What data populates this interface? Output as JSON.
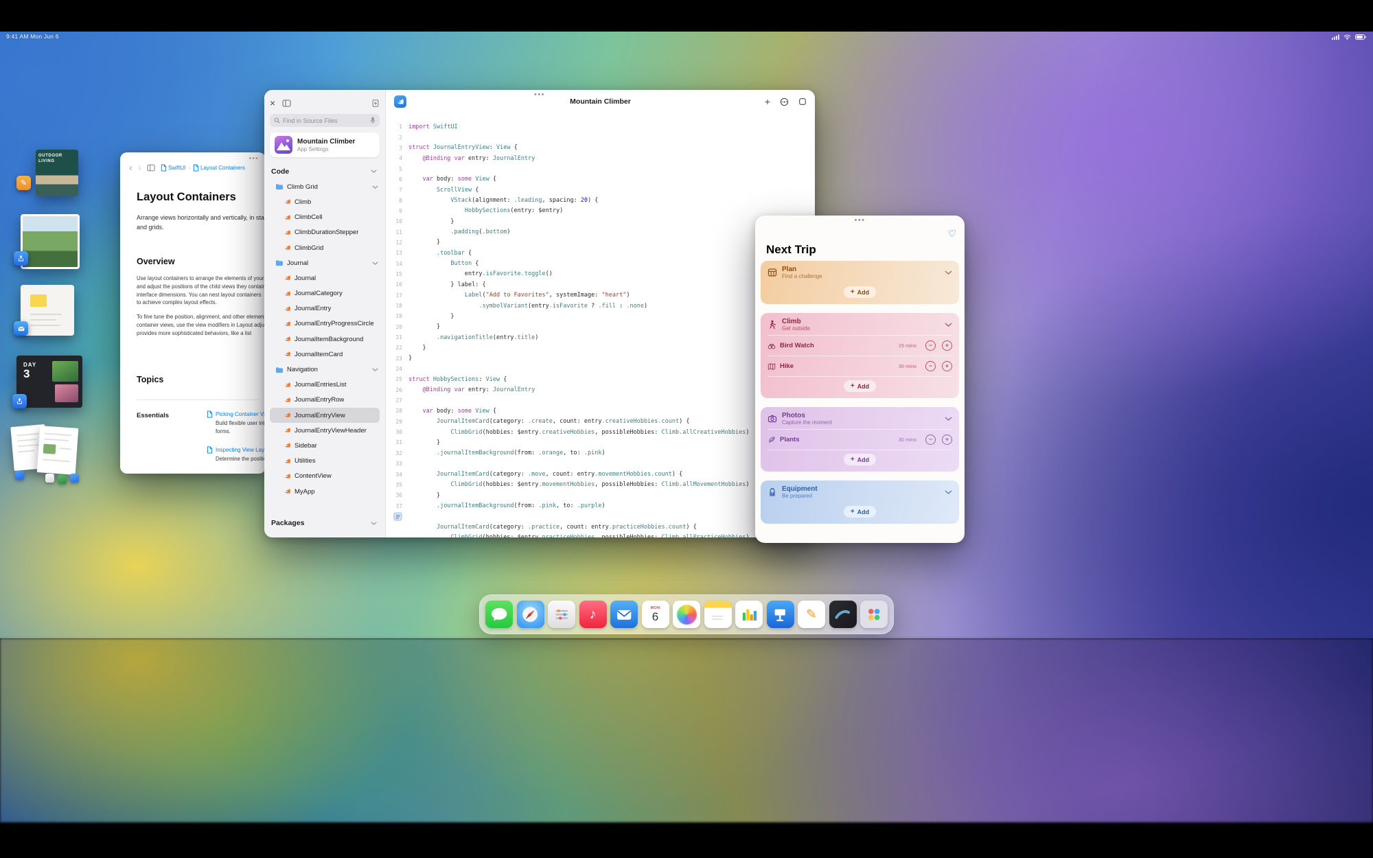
{
  "colors": {
    "accent_blue": "#0a84ff",
    "swift_orange": "#ee7733",
    "keyword_pink": "#ad3da4",
    "string_red": "#d12f1b",
    "type_teal": "#3e8087",
    "selected_row": "#d6d6db"
  },
  "menu_bar": {
    "status": "9:41 AM  Mon Jun 6"
  },
  "stage_manager": {
    "thumbnails": [
      {
        "name": "magazine-thumbnail",
        "text": "OUTDOOR\nLIVING",
        "badge": "pencil-badge"
      },
      {
        "name": "photo-thumbnail",
        "badge": "share-badge"
      },
      {
        "name": "notes-thumbnail",
        "badge": "mail-badge"
      },
      {
        "name": "collage-thumbnail",
        "text_top": "DAY",
        "text_big": "3",
        "badge": "share-badge"
      },
      {
        "name": "documents-thumbnail"
      }
    ]
  },
  "docs_window": {
    "breadcrumb": [
      "SwiftUI",
      "Layout Containers"
    ],
    "title": "Layout Containers",
    "intro_lines": [
      "Arrange views horizontally and vertically, in stacks",
      "and grids."
    ],
    "overview_heading": "Overview",
    "overview_p1": [
      "Use layout containers to arrange the elements of your",
      "and adjust the positions of the child views they contain",
      "interface dimensions. You can nest layout containers",
      "to achieve complex layout effects."
    ],
    "overview_p2": [
      "To fine tune the position, alignment, and other elements",
      "container views, use the view modifiers in Layout adjust",
      "provides more sophisticated behaviors, like a list"
    ],
    "topics_heading": "Topics",
    "essentials_label": "Essentials",
    "topic_links": [
      {
        "title": "Picking Container Views for Your Content",
        "desc": [
          "Build flexible user interfaces",
          "forms."
        ]
      },
      {
        "title": "Inspecting View Layout",
        "desc": [
          "Determine the position and extent of"
        ]
      }
    ]
  },
  "playgrounds": {
    "search_placeholder": "Find in Source Files",
    "project": {
      "name": "Mountain Climber",
      "subtitle": "App Settings"
    },
    "items": [
      {
        "label": "Code",
        "type": "section"
      },
      {
        "label": "Climb Grid",
        "type": "folder"
      },
      {
        "label": "Climb",
        "type": "file"
      },
      {
        "label": "ClimbCell",
        "type": "file"
      },
      {
        "label": "ClimbDurationStepper",
        "type": "file"
      },
      {
        "label": "ClimbGrid",
        "type": "file"
      },
      {
        "label": "Journal",
        "type": "folder"
      },
      {
        "label": "Journal",
        "type": "file"
      },
      {
        "label": "JournalCategory",
        "type": "file"
      },
      {
        "label": "JournalEntry",
        "type": "file"
      },
      {
        "label": "JournalEntryProgressCircle",
        "type": "file"
      },
      {
        "label": "JournalItemBackground",
        "type": "file"
      },
      {
        "label": "JournalItemCard",
        "type": "file"
      },
      {
        "label": "Navigation",
        "type": "folder"
      },
      {
        "label": "JournalEntriesList",
        "type": "file"
      },
      {
        "label": "JournalEntryRow",
        "type": "file"
      },
      {
        "label": "JournalEntryView",
        "type": "file",
        "selected": true
      },
      {
        "label": "JournalEntryViewHeader",
        "type": "file"
      },
      {
        "label": "Sidebar",
        "type": "file"
      },
      {
        "label": "Utilities",
        "type": "file"
      },
      {
        "label": "ContentView",
        "type": "file"
      },
      {
        "label": "MyApp",
        "type": "file"
      },
      {
        "label": "Packages",
        "type": "section",
        "gap": true
      }
    ],
    "editor": {
      "title": "Mountain Climber",
      "lines": [
        {
          "n": "1",
          "t": "import SwiftUI"
        },
        {
          "n": "2",
          "t": ""
        },
        {
          "n": "3",
          "t": "struct JournalEntryView: View {"
        },
        {
          "n": "4",
          "t": "    @Binding var entry: JournalEntry"
        },
        {
          "n": "5",
          "t": ""
        },
        {
          "n": "6",
          "t": "    var body: some View {"
        },
        {
          "n": "7",
          "t": "        ScrollView {"
        },
        {
          "n": "8",
          "t": "            VStack(alignment: .leading, spacing: 20) {"
        },
        {
          "n": "9",
          "t": "                HobbySections(entry: $entry)"
        },
        {
          "n": "10",
          "t": "            }"
        },
        {
          "n": "11",
          "t": "            .padding(.bottom)"
        },
        {
          "n": "12",
          "t": "        }"
        },
        {
          "n": "13",
          "t": "        .toolbar {"
        },
        {
          "n": "14",
          "t": "            Button {"
        },
        {
          "n": "15",
          "t": "                entry.isFavorite.toggle()"
        },
        {
          "n": "16",
          "t": "            } label: {"
        },
        {
          "n": "17",
          "t": "                Label(\"Add to Favorites\", systemImage: \"heart\")"
        },
        {
          "n": "18",
          "t": "                    .symbolVariant(entry.isFavorite ? .fill : .none)"
        },
        {
          "n": "19",
          "t": "            }"
        },
        {
          "n": "20",
          "t": "        }"
        },
        {
          "n": "21",
          "t": "        .navigationTitle(entry.title)"
        },
        {
          "n": "22",
          "t": "    }"
        },
        {
          "n": "23",
          "t": "}"
        },
        {
          "n": "24",
          "t": ""
        },
        {
          "n": "25",
          "t": "struct HobbySections: View {"
        },
        {
          "n": "26",
          "t": "    @Binding var entry: JournalEntry"
        },
        {
          "n": "27",
          "t": ""
        },
        {
          "n": "28",
          "t": "    var body: some View {"
        },
        {
          "n": "29",
          "t": "        JournalItemCard(category: .create, count: entry.creativeHobbies.count) {"
        },
        {
          "n": "30",
          "t": "            ClimbGrid(hobbies: $entry.creativeHobbies, possibleHobbies: Climb.allCreativeHobbies)"
        },
        {
          "n": "31",
          "t": "        }"
        },
        {
          "n": "32",
          "t": "        .journalItemBackground(from: .orange, to: .pink)"
        },
        {
          "n": "33",
          "t": ""
        },
        {
          "n": "34",
          "t": "        JournalItemCard(category: .move, count: entry.movementHobbies.count) {"
        },
        {
          "n": "35",
          "t": "            ClimbGrid(hobbies: $entry.movementHobbies, possibleHobbies: Climb.allMovementHobbies)"
        },
        {
          "n": "36",
          "t": "        }"
        },
        {
          "n": "37",
          "t": "        .journalItemBackground(from: .pink, to: .purple)"
        },
        {
          "n": "38",
          "t": "",
          "marker": true
        },
        {
          "n": "",
          "t": "        JournalItemCard(category: .practice, count: entry.practiceHobbies.count) {"
        },
        {
          "n": "",
          "t": "            ClimbGrid(hobbies: $entry.practiceHobbies, possibleHobbies: Climb.allPracticeHobbies)"
        }
      ]
    }
  },
  "next_trip": {
    "title": "Next Trip",
    "cards": [
      {
        "name": "Plan",
        "subtitle": "Find a challenge",
        "theme": "orange",
        "icon": "calendar-grid-icon",
        "rows": [],
        "add_label": "Add"
      },
      {
        "name": "Climb",
        "subtitle": "Get outside",
        "theme": "pink",
        "icon": "hiker-icon",
        "rows": [
          {
            "icon": "binoculars-icon",
            "label": "Bird Watch",
            "duration": "15 mins"
          },
          {
            "icon": "map-icon",
            "label": "Hike",
            "duration": "30 mins"
          }
        ],
        "add_label": "Add"
      },
      {
        "name": "Photos",
        "subtitle": "Capture the moment",
        "theme": "purple",
        "icon": "camera-icon",
        "rows": [
          {
            "icon": "leaf-icon",
            "label": "Plants",
            "duration": "30 mins"
          }
        ],
        "add_label": "Add"
      },
      {
        "name": "Equipment",
        "subtitle": "Be prepared",
        "theme": "blue",
        "icon": "backpack-icon",
        "rows": [],
        "add_label": "Add"
      }
    ]
  },
  "dock": {
    "items": [
      {
        "name": "messages"
      },
      {
        "name": "safari"
      },
      {
        "name": "settings"
      },
      {
        "name": "music"
      },
      {
        "name": "mail"
      },
      {
        "name": "calendar",
        "weekday": "MON",
        "day": "6"
      },
      {
        "name": "photos"
      },
      {
        "name": "notes"
      },
      {
        "name": "numbers"
      },
      {
        "name": "keynote"
      },
      {
        "name": "drawing"
      },
      {
        "name": "procreate"
      },
      {
        "name": "app-library"
      }
    ]
  }
}
